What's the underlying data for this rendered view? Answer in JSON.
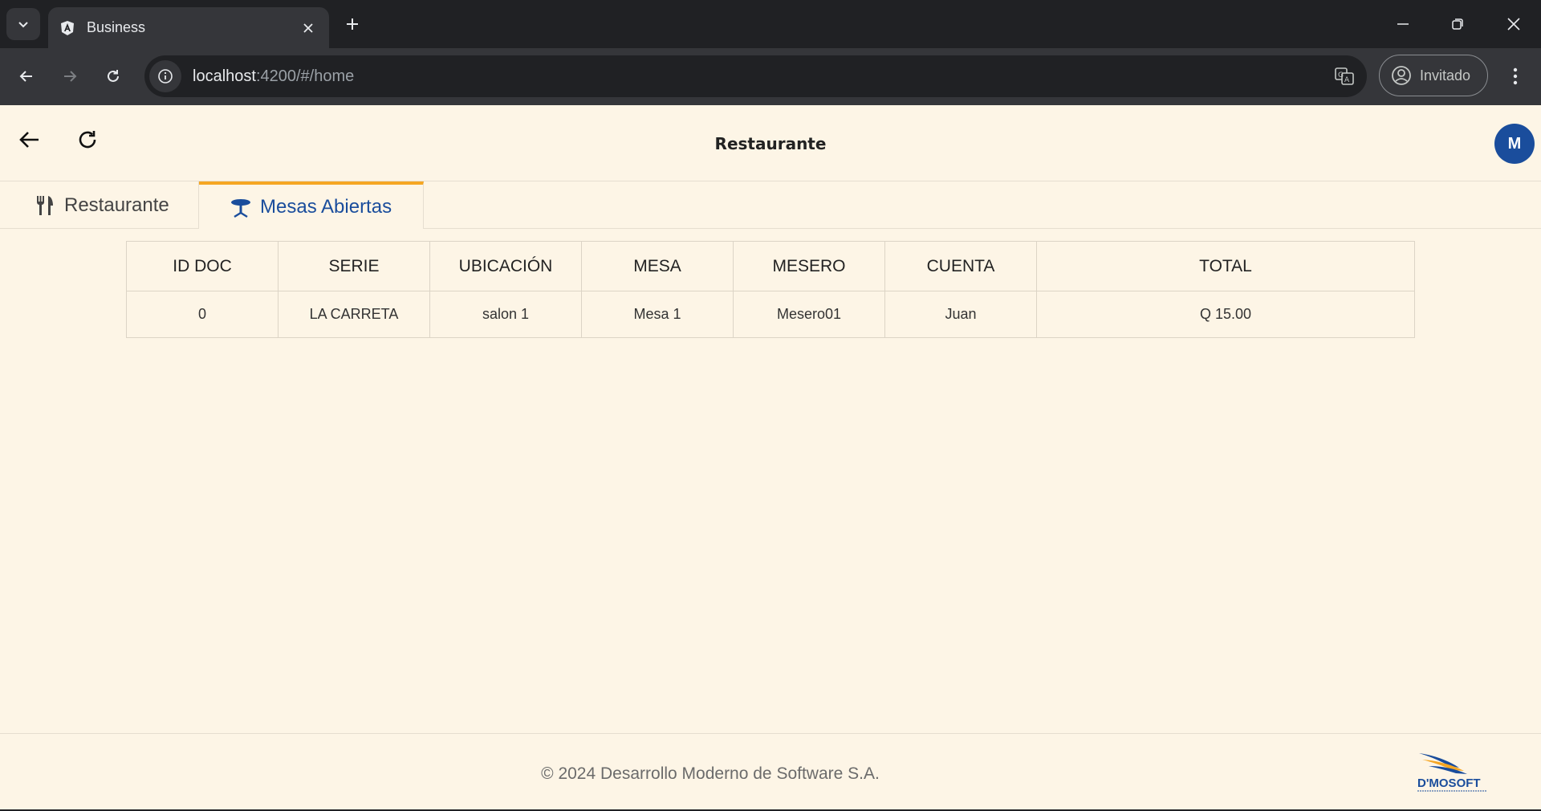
{
  "browser": {
    "tab_title": "Business",
    "url_host": "localhost",
    "url_rest": ":4200/#/home",
    "profile_label": "Invitado"
  },
  "app": {
    "title": "Restaurante",
    "avatar_initial": "M",
    "tabs": [
      {
        "label": "Restaurante",
        "icon": "utensils-icon",
        "active": false
      },
      {
        "label": "Mesas Abiertas",
        "icon": "table-icon",
        "active": true
      }
    ]
  },
  "table": {
    "headers": [
      "ID DOC",
      "SERIE",
      "UBICACIÓN",
      "MESA",
      "MESERO",
      "CUENTA",
      "TOTAL"
    ],
    "rows": [
      [
        "0",
        "LA CARRETA",
        "salon 1",
        "Mesa 1",
        "Mesero01",
        "Juan",
        "Q 15.00"
      ]
    ]
  },
  "footer": {
    "copyright": "© 2024 Desarrollo Moderno de Software S.A.",
    "logo_text": "D'MOSOFT"
  },
  "colors": {
    "accent_blue": "#1a4d9c",
    "tab_indicator": "#f5a623",
    "page_bg": "#fdf5e6"
  }
}
